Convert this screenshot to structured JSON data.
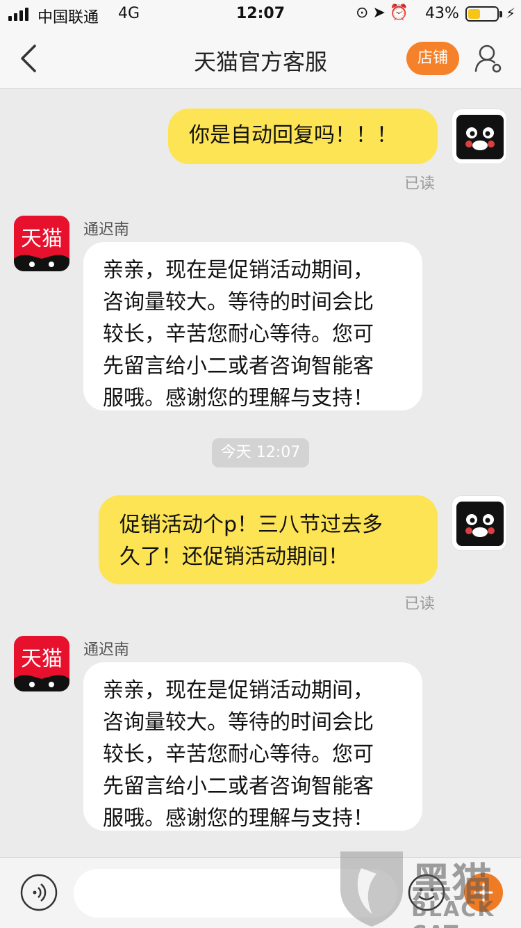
{
  "status_bar": {
    "carrier": "中国联通",
    "network": "4G",
    "time": "12:07",
    "battery_percent": "43%",
    "battery_level": 0.43,
    "battery_color": "#f5c518"
  },
  "nav": {
    "back_icon": "chevron-left-icon",
    "title": "天猫官方客服",
    "shop_button": "店铺",
    "profile_icon": "user-settings-icon",
    "accent_color": "#f5822a"
  },
  "messages": [
    {
      "from": "me",
      "text": "你是自动回复吗！！！",
      "status": "已读"
    },
    {
      "from": "agent",
      "sender": "通迟南",
      "avatar_text": "天猫",
      "lines": [
        "亲亲，现在是促销活动期间，",
        "咨询量较大。等待的时间会比",
        "较长，辛苦您耐心等待。您可",
        "先留言给小二或者咨询智能客",
        "服哦。感谢您的理解与支持！"
      ]
    },
    {
      "from": "me",
      "lines": [
        "促销活动个p！三八节过去多",
        "久了！还促销活动期间！"
      ],
      "status": "已读"
    },
    {
      "from": "agent",
      "sender": "通迟南",
      "avatar_text": "天猫",
      "lines": [
        "亲亲，现在是促销活动期间，",
        "咨询量较大。等待的时间会比",
        "较长，辛苦您耐心等待。您可",
        "先留言给小二或者咨询智能客",
        "服哦。感谢您的理解与支持！"
      ]
    }
  ],
  "timestamp": "今天 12:07",
  "input_bar": {
    "voice_icon": "voice-icon",
    "text_value": "",
    "emoji_icon": "emoji-icon",
    "plus_icon": "plus-icon"
  },
  "watermark": {
    "cn": "黑猫",
    "en": "BLACK CAT"
  },
  "colors": {
    "my_bubble": "#fde455",
    "their_bubble": "#ffffff",
    "background": "#ebebeb",
    "tmall_red": "#e8112d"
  }
}
